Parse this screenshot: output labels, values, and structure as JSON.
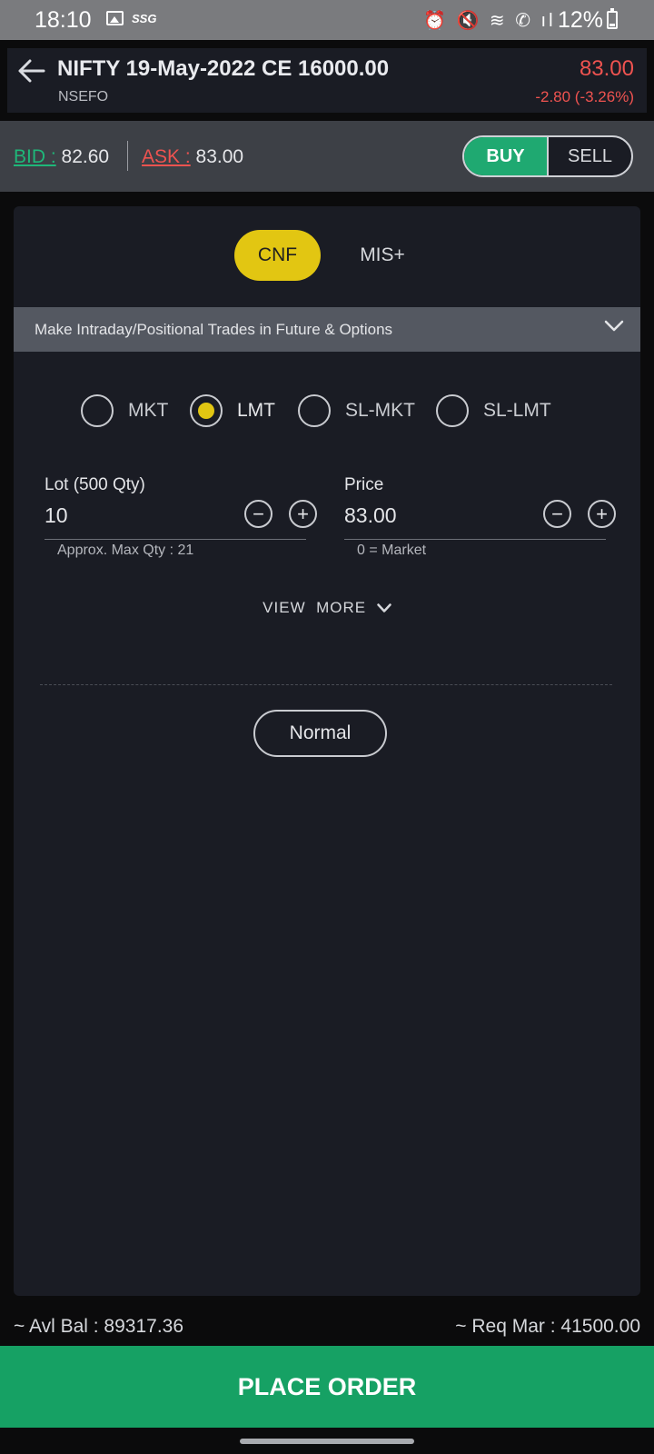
{
  "status_bar": {
    "time": "18:10",
    "carrier_badge": "SSG",
    "system_icons": "⏰ 🔇 ≋ ✆ ıl",
    "battery": "12%"
  },
  "header": {
    "title": "NIFTY 19-May-2022 CE 16000.00",
    "exchange": "NSEFO",
    "ltp": "83.00",
    "change": "-2.80 (-3.26%)"
  },
  "quote": {
    "bid_label": "BID :",
    "bid_value": "82.60",
    "ask_label": "ASK :",
    "ask_value": "83.00"
  },
  "side_toggle": {
    "buy": "BUY",
    "sell": "SELL",
    "selected": "BUY"
  },
  "product_tabs": {
    "items": [
      "CNF",
      "MIS+"
    ],
    "selected": "CNF"
  },
  "info_strip": {
    "text": "Make Intraday/Positional Trades in Future & Options"
  },
  "order_types": {
    "items": [
      "MKT",
      "LMT",
      "SL-MKT",
      "SL-LMT"
    ],
    "selected": "LMT"
  },
  "lot_field": {
    "label": "Lot (500 Qty)",
    "value": "10",
    "hint": "Approx. Max Qty : 21"
  },
  "price_field": {
    "label": "Price",
    "value": "83.00",
    "hint": "0 = Market"
  },
  "view_more": "VIEW  MORE",
  "validity_button": "Normal",
  "footer": {
    "avl_bal": "~ Avl Bal : 89317.36",
    "req_mar": "~ Req Mar : 41500.00",
    "place_order": "PLACE ORDER"
  },
  "colors": {
    "buy_green": "#1fa971",
    "sell_red": "#ef5350",
    "accent_yellow": "#e2c612",
    "panel_bg": "#1a1c24"
  }
}
